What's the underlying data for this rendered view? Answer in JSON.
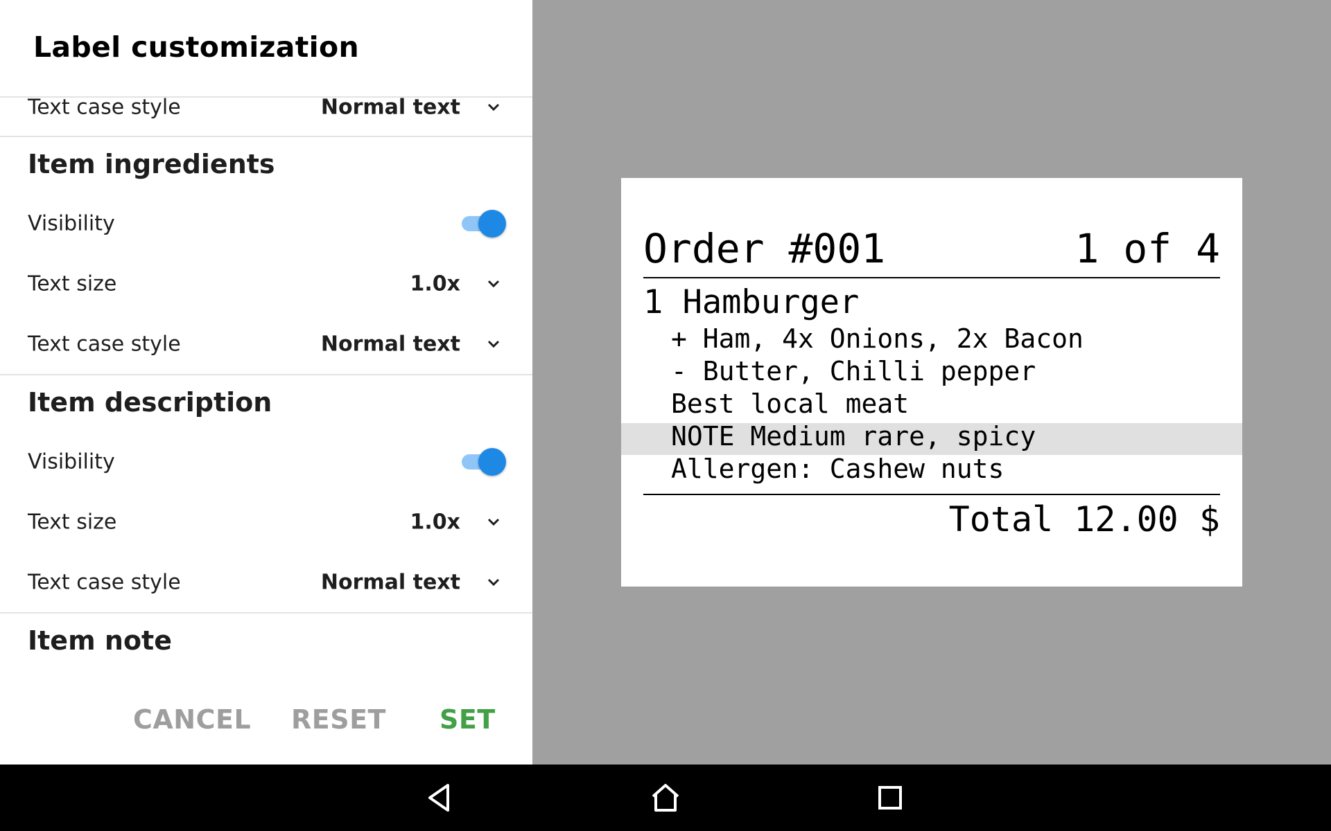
{
  "panel": {
    "title": "Label customization",
    "top_row": {
      "label": "Text case style",
      "value": "Normal text"
    },
    "sections": [
      {
        "heading": "Item ingredients",
        "visibility_label": "Visibility",
        "visibility_on": true,
        "text_size_label": "Text size",
        "text_size_value": "1.0x",
        "text_case_label": "Text case style",
        "text_case_value": "Normal text"
      },
      {
        "heading": "Item description",
        "visibility_label": "Visibility",
        "visibility_on": true,
        "text_size_label": "Text size",
        "text_size_value": "1.0x",
        "text_case_label": "Text case style",
        "text_case_value": "Normal text"
      },
      {
        "heading": "Item note"
      }
    ],
    "actions": {
      "cancel": "CANCEL",
      "reset": "RESET",
      "set": "SET"
    },
    "colors": {
      "toggle_on": "#1e88e5",
      "set_button": "#43a047",
      "inactive_button": "#9e9e9e"
    }
  },
  "receipt": {
    "order": "Order #001",
    "page": "1 of 4",
    "item": "1 Hamburger",
    "lines": [
      "+ Ham, 4x Onions, 2x Bacon",
      "- Butter, Chilli pepper",
      "Best local meat",
      "NOTE Medium rare, spicy",
      "Allergen: Cashew nuts"
    ],
    "total": "Total 12.00 $"
  },
  "navbar": {
    "icons": [
      "back-icon",
      "home-icon",
      "recents-icon"
    ]
  }
}
